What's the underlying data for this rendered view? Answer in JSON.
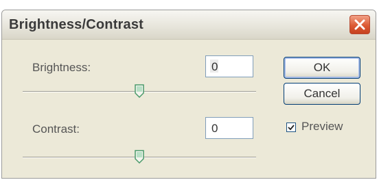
{
  "window": {
    "title": "Brightness/Contrast",
    "close_icon": "close-x-icon"
  },
  "brightness": {
    "label": "Brightness:",
    "value": "0",
    "slider_position": 0.5
  },
  "contrast": {
    "label": "Contrast:",
    "value": "0",
    "slider_position": 0.5
  },
  "buttons": {
    "ok_label": "OK",
    "cancel_label": "Cancel"
  },
  "preview": {
    "label": "Preview",
    "checked": true
  },
  "colors": {
    "dialog_bg": "#ece9d8",
    "close_button": "#dc5a34",
    "slider_thumb": "#4a9a6a"
  }
}
